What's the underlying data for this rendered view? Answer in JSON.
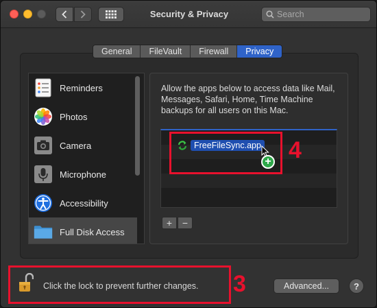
{
  "window": {
    "title": "Security & Privacy",
    "search_placeholder": "Search"
  },
  "tabs": [
    {
      "label": "General",
      "active": false
    },
    {
      "label": "FileVault",
      "active": false
    },
    {
      "label": "Firewall",
      "active": false
    },
    {
      "label": "Privacy",
      "active": true
    }
  ],
  "sidebar": {
    "items": [
      {
        "label": "Reminders",
        "icon": "reminders-icon"
      },
      {
        "label": "Photos",
        "icon": "photos-icon"
      },
      {
        "label": "Camera",
        "icon": "camera-icon"
      },
      {
        "label": "Microphone",
        "icon": "microphone-icon"
      },
      {
        "label": "Accessibility",
        "icon": "accessibility-icon"
      },
      {
        "label": "Full Disk Access",
        "icon": "folder-icon",
        "selected": true
      }
    ]
  },
  "panel": {
    "description": "Allow the apps below to access data like Mail, Messages, Safari, Home, Time Machine backups for all users on this Mac.",
    "dragged_app": "FreeFileSync.app",
    "add_label": "+",
    "remove_label": "−"
  },
  "annotations": {
    "step_four": "4",
    "step_three": "3",
    "color": "#e8112d"
  },
  "footer": {
    "lock_text": "Click the lock to prevent further changes.",
    "advanced_label": "Advanced...",
    "help_label": "?"
  },
  "colors": {
    "accent": "#2f63c8",
    "window_bg": "#323232"
  }
}
